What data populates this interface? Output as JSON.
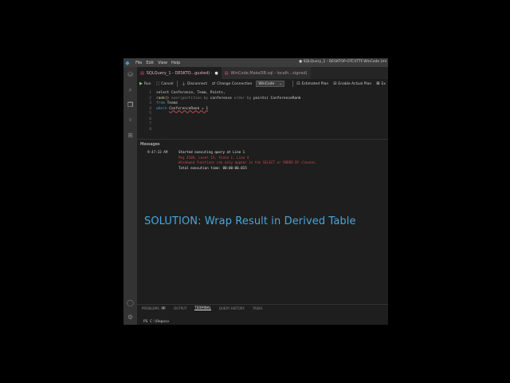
{
  "titlebar": {
    "menu": [
      "File",
      "Edit",
      "View",
      "Help"
    ],
    "title": "● SQLQuery_1 - DESKTOP-OTCVTTF.WinCode (mi"
  },
  "tabs": [
    {
      "label": "SQLQuery_1 - DESKTO...gusted) ·",
      "active": true
    },
    {
      "label": "WinCode.MakeDB.sql - localh...signed)",
      "active": false
    }
  ],
  "toolbar": {
    "run": "Run",
    "cancel": "Cancel",
    "disconnect": "Disconnect",
    "change_connection": "Change Connection",
    "database": "WinCode",
    "estimated_plan": "Estimated Plan",
    "enable_actual_plan": "Enable Actual Plan",
    "explain": "Ex"
  },
  "editor": {
    "line_numbers": [
      "1",
      "2",
      "3",
      "4",
      "5",
      "6",
      "7",
      "8"
    ],
    "line1": "select Conference, Team, Points,",
    "line2_kw": "rank()",
    "line2_over": "over(partition by",
    "line2_mid": "conference",
    "line2_order": "order by",
    "line2_end": "points) ConferenceRank",
    "line3_kw": "from",
    "line3_rest": "Teams",
    "line4_kw": "where",
    "line4_rest": "ConferenceRank = 1"
  },
  "results": {
    "header": "Messages",
    "time": "9:47:33 AM",
    "lines": [
      "Started executing query at Line 1",
      "Msg 4108, Level 15, State 1, Line 4",
      "Windowed functions can only appear in the SELECT or ORDER BY clauses.",
      "Total execution time: 00:00:00.015"
    ]
  },
  "overlay": "SOLUTION:  Wrap Result in Derived Table",
  "panel": {
    "tabs": [
      "PROBLEMS",
      "OUTPUT",
      "TERMINAL",
      "QUERY HISTORY",
      "TASKS"
    ],
    "problems_count": "1"
  },
  "terminal": {
    "prompt": "PS C:\\Repos>"
  }
}
